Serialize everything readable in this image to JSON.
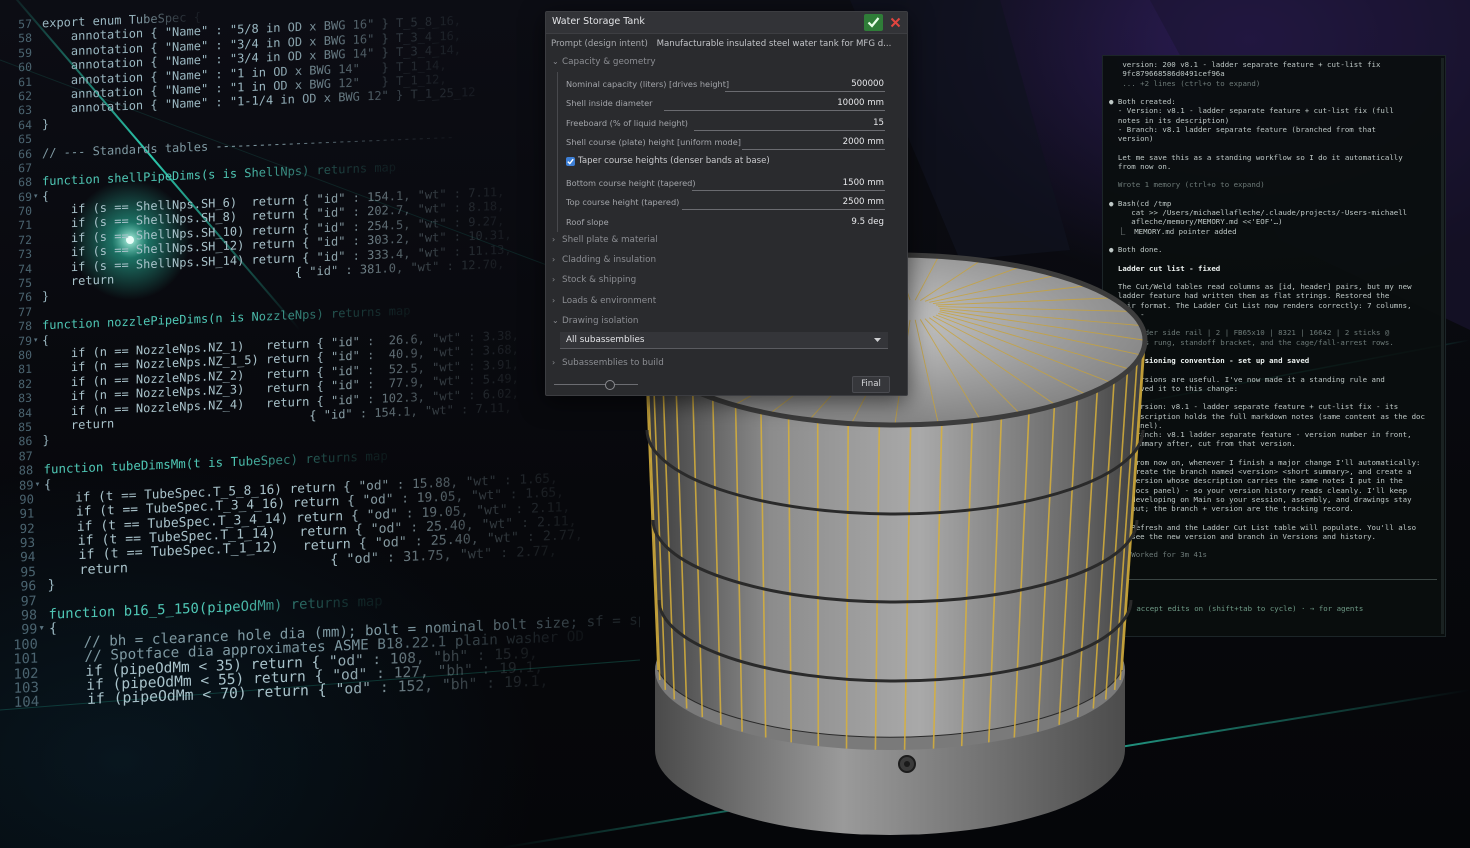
{
  "dialog": {
    "title": "Water Storage Tank",
    "prompt_label": "Prompt (design intent)",
    "prompt_value": "Manufacturable insulated steel water tank for MFG d...",
    "sections": {
      "capacity": "Capacity & geometry",
      "shell_plate": "Shell plate & material",
      "cladding": "Cladding & insulation",
      "stock": "Stock & shipping",
      "loads": "Loads & environment",
      "drawing": "Drawing isolation",
      "subassemblies": "Subassemblies to build"
    },
    "fields": {
      "nominal_capacity_label": "Nominal capacity (liters) [drives height]",
      "nominal_capacity_value": "500000",
      "shell_diameter_label": "Shell inside diameter",
      "shell_diameter_value": "10000 mm",
      "freeboard_label": "Freeboard (% of liquid height)",
      "freeboard_value": "15",
      "course_height_label": "Shell course (plate) height [uniform mode]",
      "course_height_value": "2000 mm",
      "taper_label": "Taper course heights (denser bands at base)",
      "taper_checked": true,
      "bottom_course_label": "Bottom course height (tapered)",
      "bottom_course_value": "1500 mm",
      "top_course_label": "Top course height (tapered)",
      "top_course_value": "2500 mm",
      "roof_slope_label": "Roof slope",
      "roof_slope_value": "9.5 deg"
    },
    "drawing_select_value": "All subassemblies",
    "final_button": "Final"
  },
  "code": {
    "lines": [
      {
        "n": "57",
        "t": "export enum TubeSpec {",
        "fold": ""
      },
      {
        "n": "58",
        "t": "    annotation { \"Name\" : \"5/8 in OD x BWG 16\" } T_5_8_16,",
        "fold": ""
      },
      {
        "n": "59",
        "t": "    annotation { \"Name\" : \"3/4 in OD x BWG 16\" } T_3_4_16,",
        "fold": ""
      },
      {
        "n": "60",
        "t": "    annotation { \"Name\" : \"3/4 in OD x BWG 14\" } T_3_4_14,",
        "fold": ""
      },
      {
        "n": "61",
        "t": "    annotation { \"Name\" : \"1 in OD x BWG 14\"   } T_1_14,",
        "fold": ""
      },
      {
        "n": "62",
        "t": "    annotation { \"Name\" : \"1 in OD x BWG 12\"   } T_1_12,",
        "fold": ""
      },
      {
        "n": "63",
        "t": "    annotation { \"Name\" : \"1-1/4 in OD x BWG 12\" } T_1_25_12",
        "fold": ""
      },
      {
        "n": "64",
        "t": "}",
        "fold": ""
      },
      {
        "n": "65",
        "t": "",
        "fold": ""
      },
      {
        "n": "66",
        "t": "// --- Standards tables ---------------------------------",
        "fold": ""
      },
      {
        "n": "67",
        "t": "",
        "fold": ""
      },
      {
        "n": "68",
        "t": "function shellPipeDims(s is ShellNps) returns map",
        "fold": ""
      },
      {
        "n": "69",
        "t": "{",
        "fold": "v"
      },
      {
        "n": "70",
        "t": "    if (s == ShellNps.SH_6)  return { \"id\" : 154.1, \"wt\" : 7.11,",
        "fold": ""
      },
      {
        "n": "71",
        "t": "    if (s == ShellNps.SH_8)  return { \"id\" : 202.7, \"wt\" : 8.18,",
        "fold": ""
      },
      {
        "n": "72",
        "t": "    if (s == ShellNps.SH_10) return { \"id\" : 254.5, \"wt\" : 9.27,",
        "fold": ""
      },
      {
        "n": "73",
        "t": "    if (s == ShellNps.SH_12) return { \"id\" : 303.2, \"wt\" : 10.31,",
        "fold": ""
      },
      {
        "n": "74",
        "t": "    if (s == ShellNps.SH_14) return { \"id\" : 333.4, \"wt\" : 11.13,",
        "fold": ""
      },
      {
        "n": "75",
        "t": "    return                         { \"id\" : 381.0, \"wt\" : 12.70,",
        "fold": ""
      },
      {
        "n": "76",
        "t": "}",
        "fold": ""
      },
      {
        "n": "77",
        "t": "",
        "fold": ""
      },
      {
        "n": "78",
        "t": "function nozzlePipeDims(n is NozzleNps) returns map",
        "fold": ""
      },
      {
        "n": "79",
        "t": "{",
        "fold": "v"
      },
      {
        "n": "80",
        "t": "    if (n == NozzleNps.NZ_1)   return { \"id\" :  26.6, \"wt\" : 3.38,",
        "fold": ""
      },
      {
        "n": "81",
        "t": "    if (n == NozzleNps.NZ_1_5) return { \"id\" :  40.9, \"wt\" : 3.68,",
        "fold": ""
      },
      {
        "n": "82",
        "t": "    if (n == NozzleNps.NZ_2)   return { \"id\" :  52.5, \"wt\" : 3.91,",
        "fold": ""
      },
      {
        "n": "83",
        "t": "    if (n == NozzleNps.NZ_3)   return { \"id\" :  77.9, \"wt\" : 5.49,",
        "fold": ""
      },
      {
        "n": "84",
        "t": "    if (n == NozzleNps.NZ_4)   return { \"id\" : 102.3, \"wt\" : 6.02,",
        "fold": ""
      },
      {
        "n": "85",
        "t": "    return                           { \"id\" : 154.1, \"wt\" : 7.11,",
        "fold": ""
      },
      {
        "n": "86",
        "t": "}",
        "fold": ""
      },
      {
        "n": "87",
        "t": "",
        "fold": ""
      },
      {
        "n": "88",
        "t": "function tubeDimsMm(t is TubeSpec) returns map",
        "fold": ""
      },
      {
        "n": "89",
        "t": "{",
        "fold": "v"
      },
      {
        "n": "90",
        "t": "    if (t == TubeSpec.T_5_8_16) return { \"od\" : 15.88, \"wt\" : 1.65,",
        "fold": ""
      },
      {
        "n": "91",
        "t": "    if (t == TubeSpec.T_3_4_16) return { \"od\" : 19.05, \"wt\" : 1.65,",
        "fold": ""
      },
      {
        "n": "92",
        "t": "    if (t == TubeSpec.T_3_4_14) return { \"od\" : 19.05, \"wt\" : 2.11,",
        "fold": ""
      },
      {
        "n": "93",
        "t": "    if (t == TubeSpec.T_1_14)   return { \"od\" : 25.40, \"wt\" : 2.11,",
        "fold": ""
      },
      {
        "n": "94",
        "t": "    if (t == TubeSpec.T_1_12)   return { \"od\" : 25.40, \"wt\" : 2.77,",
        "fold": ""
      },
      {
        "n": "95",
        "t": "    return                         { \"od\" : 31.75, \"wt\" : 2.77,",
        "fold": ""
      },
      {
        "n": "96",
        "t": "}",
        "fold": ""
      },
      {
        "n": "97",
        "t": "",
        "fold": ""
      },
      {
        "n": "98",
        "t": "function b16_5_150(pipeOdMm) returns map",
        "fold": ""
      },
      {
        "n": "99",
        "t": "{",
        "fold": "v"
      },
      {
        "n": "100",
        "t": "    // bh = clearance hole dia (mm); bolt = nominal bolt size; sf = spotface",
        "fold": ""
      },
      {
        "n": "101",
        "t": "    // Spotface dia approximates ASME B18.22.1 plain washer OD",
        "fold": ""
      },
      {
        "n": "102",
        "t": "    if (pipeOdMm < 35) return { \"od\" : 108, \"bh\" : 15.9,",
        "fold": ""
      },
      {
        "n": "103",
        "t": "    if (pipeOdMm < 55) return { \"od\" : 127, \"bh\" : 19.1,",
        "fold": ""
      },
      {
        "n": "104",
        "t": "    if (pipeOdMm < 70) return { \"od\" : 152, \"bh\" : 19.1,",
        "fold": ""
      }
    ]
  },
  "terminal": {
    "lines": [
      {
        "t": "   version: 200 v8.1 - ladder separate feature + cut-list fix",
        "c": ""
      },
      {
        "t": "   9fc879668586d0491cef96a",
        "c": ""
      },
      {
        "t": "   ... +2 lines (ctrl+o to expand)",
        "c": "dim"
      },
      {
        "t": "",
        "c": ""
      },
      {
        "t": "● Both created:",
        "c": ""
      },
      {
        "t": "  - Version: v8.1 - ladder separate feature + cut-list fix (full",
        "c": ""
      },
      {
        "t": "  notes in its description)",
        "c": ""
      },
      {
        "t": "  - Branch: v8.1 ladder separate feature (branched from that",
        "c": ""
      },
      {
        "t": "  version)",
        "c": ""
      },
      {
        "t": "",
        "c": ""
      },
      {
        "t": "  Let me save this as a standing workflow so I do it automatically",
        "c": ""
      },
      {
        "t": "  from now on.",
        "c": ""
      },
      {
        "t": "",
        "c": ""
      },
      {
        "t": "  Wrote 1 memory (ctrl+o to expand)",
        "c": "dim"
      },
      {
        "t": "",
        "c": ""
      },
      {
        "t": "● Bash(cd /tmp",
        "c": ""
      },
      {
        "t": "     cat >> /Users/michaellafleche/.claude/projects/-Users-michaell",
        "c": ""
      },
      {
        "t": "     afleche/memory/MEMORY.md <<'EOF'…)",
        "c": ""
      },
      {
        "t": "  ⎿  MEMORY.md pointer added",
        "c": ""
      },
      {
        "t": "",
        "c": ""
      },
      {
        "t": "● Both done.",
        "c": ""
      },
      {
        "t": "",
        "c": ""
      },
      {
        "t": "  Ladder cut list - fixed",
        "c": "bold"
      },
      {
        "t": "",
        "c": ""
      },
      {
        "t": "  The Cut/Weld tables read columns as [id, header] pairs, but my new",
        "c": ""
      },
      {
        "t": "  ladder feature had written them as flat strings. Restored the",
        "c": ""
      },
      {
        "t": "  pair format. The Ladder Cut List now renders correctly: 7 columns,",
        "c": ""
      },
      {
        "t": "  rows -",
        "c": ""
      },
      {
        "t": "",
        "c": ""
      },
      {
        "t": "     ladder side rail | 2 | FB65x10 | 8321 | 16642 | 2 sticks @",
        "c": "dim"
      },
      {
        "t": "     plus rung, standoff bracket, and the cage/fall-arrest rows.",
        "c": "dim"
      },
      {
        "t": "",
        "c": ""
      },
      {
        "t": "     Versioning convention - set up and saved",
        "c": "bold"
      },
      {
        "t": "",
        "c": ""
      },
      {
        "t": "     Versions are useful. I've now made it a standing rule and",
        "c": ""
      },
      {
        "t": "     saved it to this change:",
        "c": ""
      },
      {
        "t": "",
        "c": ""
      },
      {
        "t": "     Version: v8.1 - ladder separate feature + cut-list fix - its",
        "c": ""
      },
      {
        "t": "     description holds the full markdown notes (same content as the doc",
        "c": ""
      },
      {
        "t": "     panel).",
        "c": ""
      },
      {
        "t": "     Branch: v8.1 ladder separate feature - version number in front,",
        "c": ""
      },
      {
        "t": "     summary after, cut from that version.",
        "c": ""
      },
      {
        "t": "",
        "c": ""
      },
      {
        "t": "     From now on, whenever I finish a major change I'll automatically:",
        "c": ""
      },
      {
        "t": "     create the branch named <version> <short summary>, and create a",
        "c": ""
      },
      {
        "t": "     version whose description carries the same notes I put in the",
        "c": ""
      },
      {
        "t": "     docs panel) - so your version history reads cleanly. I'll keep",
        "c": ""
      },
      {
        "t": "     developing on Main so your session, assembly, and drawings stay",
        "c": ""
      },
      {
        "t": "     put; the branch + version are the tracking record.",
        "c": ""
      },
      {
        "t": "",
        "c": ""
      },
      {
        "t": "     Refresh and the Ladder Cut List table will populate. You'll also",
        "c": ""
      },
      {
        "t": "     see the new version and branch in Versions and history.",
        "c": ""
      },
      {
        "t": "",
        "c": ""
      },
      {
        "t": "     Worked for 3m 41s",
        "c": "dim"
      }
    ],
    "footer": "▸▸ accept edits on (shift+tab to cycle) · → for agents"
  },
  "colors": {
    "accent_green": "#2f7d38",
    "checkbox_blue": "#3d7fd6",
    "code_keyword": "#3fb6a6",
    "glow_cyan": "#2fe0c0",
    "cladding_yellow": "#d9b13a"
  },
  "icons": [
    "check-icon",
    "close-icon",
    "chevron-down-icon",
    "chevron-right-icon",
    "caret-down-icon"
  ]
}
